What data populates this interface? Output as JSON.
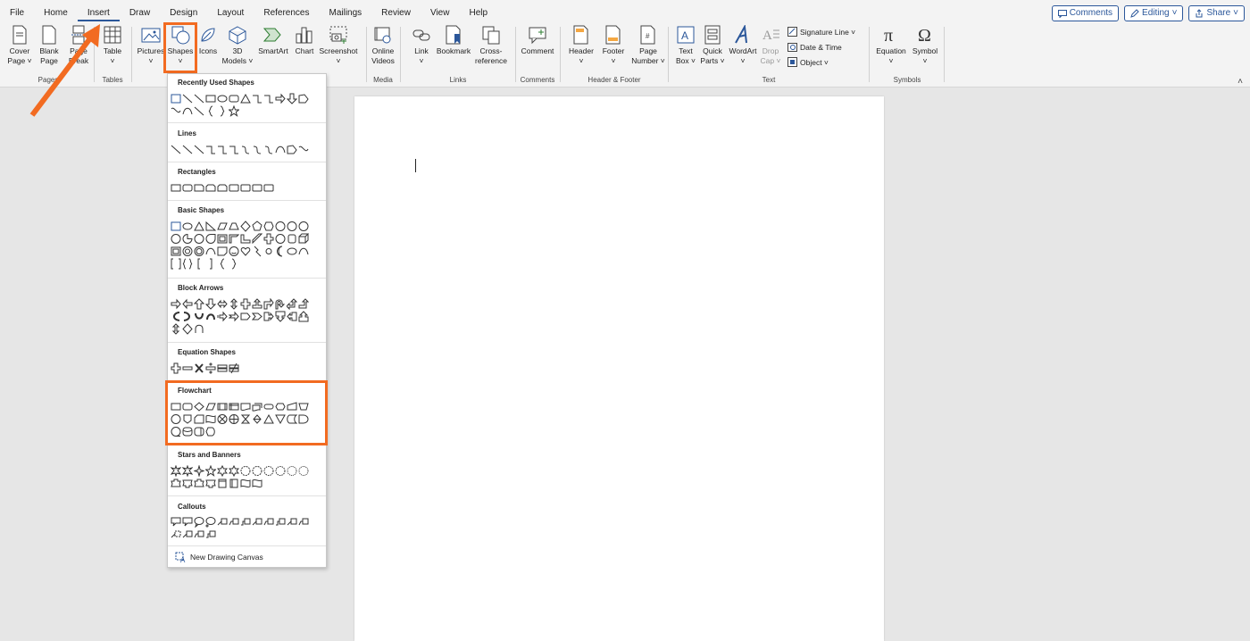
{
  "menu": {
    "tabs": [
      "File",
      "Home",
      "Insert",
      "Draw",
      "Design",
      "Layout",
      "References",
      "Mailings",
      "Review",
      "View",
      "Help"
    ],
    "active": "Insert"
  },
  "topright": {
    "comments": "Comments",
    "editing": "Editing",
    "share": "Share"
  },
  "ribbon": {
    "pages": {
      "cover": [
        "Cover",
        "Page ˅"
      ],
      "blank": [
        "Blank",
        "Page"
      ],
      "break": [
        "Page",
        "Break"
      ],
      "label": "Pages"
    },
    "tables": {
      "table": [
        "Table",
        "˅"
      ],
      "label": "Tables"
    },
    "illustrations": {
      "pictures": [
        "Pictures",
        "˅"
      ],
      "shapes": [
        "Shapes",
        "˅"
      ],
      "icons": [
        "Icons",
        ""
      ],
      "models": [
        "3D",
        "Models ˅"
      ],
      "smartart": [
        "SmartArt",
        ""
      ],
      "chart": [
        "Chart",
        ""
      ],
      "screenshot": [
        "Screenshot",
        "˅"
      ]
    },
    "media": {
      "videos": [
        "Online",
        "Videos"
      ],
      "label": "Media"
    },
    "links": {
      "link": [
        "Link",
        "˅"
      ],
      "bookmark": [
        "Bookmark",
        ""
      ],
      "cross": [
        "Cross-",
        "reference"
      ],
      "label": "Links"
    },
    "comments": {
      "comment": [
        "Comment",
        ""
      ],
      "label": "Comments"
    },
    "hf": {
      "header": [
        "Header",
        "˅"
      ],
      "footer": [
        "Footer",
        "˅"
      ],
      "pagenum": [
        "Page",
        "Number ˅"
      ],
      "label": "Header & Footer"
    },
    "text": {
      "textbox": [
        "Text",
        "Box ˅"
      ],
      "quickparts": [
        "Quick",
        "Parts ˅"
      ],
      "wordart": [
        "WordArt",
        "˅"
      ],
      "dropcap": [
        "Drop",
        "Cap ˅"
      ],
      "signature": "Signature Line ˅",
      "datetime": "Date & Time",
      "object": "Object ˅",
      "label": "Text"
    },
    "symbols": {
      "equation": [
        "Equation",
        "˅"
      ],
      "symbol": [
        "Symbol",
        "˅"
      ],
      "label": "Symbols"
    }
  },
  "dropdown": {
    "sections": [
      "Recently Used Shapes",
      "Lines",
      "Rectangles",
      "Basic Shapes",
      "Block Arrows",
      "Equation Shapes",
      "Flowchart",
      "Stars and Banners",
      "Callouts"
    ],
    "canvas": "New Drawing Canvas"
  },
  "colors": {
    "accent": "#2b579a",
    "highlight": "#f26b21"
  }
}
